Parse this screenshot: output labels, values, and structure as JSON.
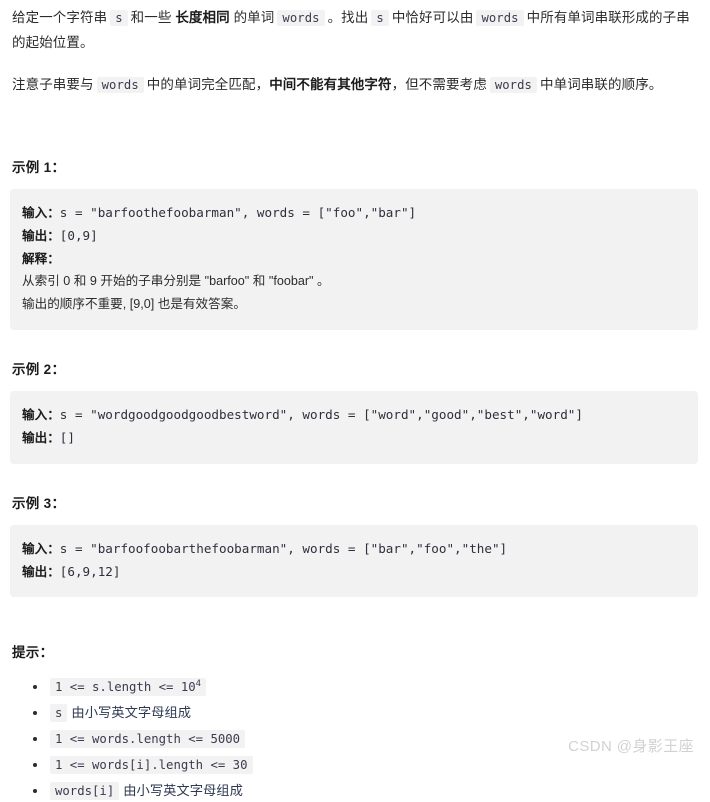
{
  "document": {
    "intro": {
      "paragraph1": {
        "seg1": "给定一个字符串",
        "code1": "s",
        "seg2": "和一些",
        "bold1": "长度相同",
        "seg3": "的单词",
        "code2": "words",
        "seg4": "。找出",
        "code3": "s",
        "seg5": "中恰好可以由",
        "code4": "words",
        "seg6": "中所有单词串联形成的子串的起始位置。"
      },
      "paragraph2": {
        "seg1": "注意子串要与",
        "code1": "words",
        "seg2": "中的单词完全匹配，",
        "bold1": "中间不能有其他字符",
        "seg3": "，但不需要考虑",
        "code2": "words",
        "seg4": "中单词串联的顺序。"
      }
    },
    "examples": [
      {
        "heading": "示例 1：",
        "lines": [
          {
            "label": "输入：",
            "code": "s = \"barfoothefoobarman\", words = [\"foo\",\"bar\"]"
          },
          {
            "label": "输出：",
            "code": "[0,9]"
          },
          {
            "label": "解释：",
            "code": ""
          },
          {
            "label": "",
            "chinese": "从索引 0 和 9 开始的子串分别是 \"barfoo\" 和 \"foobar\" 。"
          },
          {
            "label": "",
            "chinese": "输出的顺序不重要, [9,0] 也是有效答案。"
          }
        ]
      },
      {
        "heading": "示例 2：",
        "lines": [
          {
            "label": "输入：",
            "code": "s = \"wordgoodgoodgoodbestword\", words = [\"word\",\"good\",\"best\",\"word\"]"
          },
          {
            "label": "输出：",
            "code": "[]"
          }
        ]
      },
      {
        "heading": "示例 3：",
        "lines": [
          {
            "label": "输入：",
            "code": "s = \"barfoofoobarthefoobarman\", words = [\"bar\",\"foo\",\"the\"]"
          },
          {
            "label": "输出：",
            "code": "[6,9,12]"
          }
        ]
      }
    ],
    "hints": {
      "heading": "提示：",
      "items": [
        {
          "code": "1 <= s.length <= 10",
          "sup": "4",
          "text": ""
        },
        {
          "code": "s",
          "sup": "",
          "text": "由小写英文字母组成"
        },
        {
          "code": "1 <= words.length <= 5000",
          "sup": "",
          "text": ""
        },
        {
          "code": "1 <= words[i].length <= 30",
          "sup": "",
          "text": ""
        },
        {
          "code": "words[i]",
          "sup": "",
          "text": "由小写英文字母组成"
        }
      ]
    },
    "watermark": "CSDN @身影王座"
  }
}
